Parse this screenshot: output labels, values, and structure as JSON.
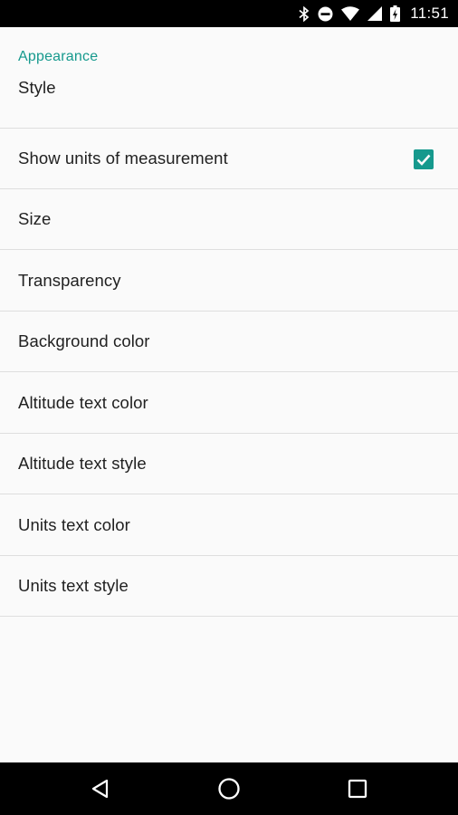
{
  "status_bar": {
    "time": "11:51",
    "icons": [
      "bluetooth-icon",
      "do-not-disturb-icon",
      "wifi-icon",
      "cell-signal-icon",
      "battery-icon"
    ]
  },
  "settings": {
    "category_title": "Appearance",
    "items": [
      {
        "label": "Style"
      },
      {
        "label": "Show units of measurement",
        "checked": true
      },
      {
        "label": "Size"
      },
      {
        "label": "Transparency"
      },
      {
        "label": "Background color"
      },
      {
        "label": "Altitude text color"
      },
      {
        "label": "Altitude text style"
      },
      {
        "label": "Units text color"
      },
      {
        "label": "Units text style"
      }
    ]
  },
  "nav_bar": {
    "buttons": [
      "back-icon",
      "home-icon",
      "recents-icon"
    ]
  },
  "colors": {
    "accent": "#16998d",
    "text_primary": "#212121",
    "background": "#fafafa",
    "divider": "#dedede"
  }
}
